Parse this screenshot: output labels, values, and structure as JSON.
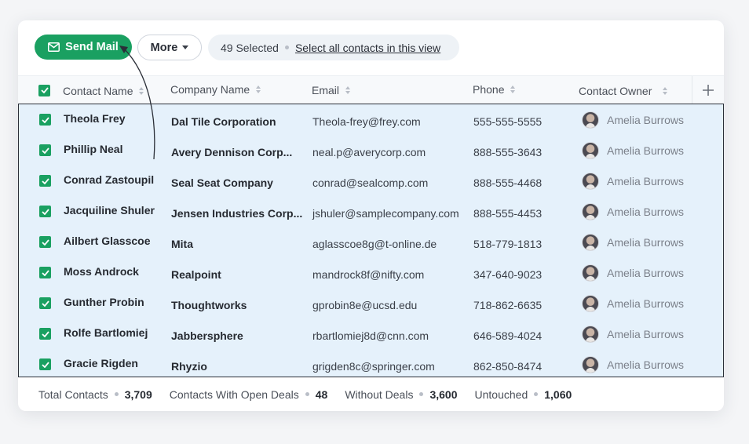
{
  "toolbar": {
    "send_mail_label": "Send Mail",
    "more_label": "More",
    "selected_count_label": "49 Selected",
    "select_all_label": "Select all contacts in this view"
  },
  "columns": {
    "contact_name": "Contact Name",
    "company_name": "Company Name",
    "email": "Email",
    "phone": "Phone",
    "contact_owner": "Contact Owner"
  },
  "rows": [
    {
      "name": "Theola Frey",
      "company": "Dal Tile Corporation",
      "email": "Theola-frey@frey.com",
      "phone": "555-555-5555",
      "owner": "Amelia Burrows"
    },
    {
      "name": "Phillip Neal",
      "company": "Avery Dennison Corp...",
      "email": "neal.p@averycorp.com",
      "phone": "888-555-3643",
      "owner": "Amelia Burrows"
    },
    {
      "name": "Conrad Zastoupil",
      "company": "Seal Seat Company",
      "email": "conrad@sealcomp.com",
      "phone": "888-555-4468",
      "owner": "Amelia Burrows"
    },
    {
      "name": "Jacquiline Shuler",
      "company": "Jensen Industries Corp...",
      "email": "jshuler@samplecompany.com",
      "phone": "888-555-4453",
      "owner": "Amelia Burrows"
    },
    {
      "name": "Ailbert Glasscoe",
      "company": "Mita",
      "email": "aglasscoe8g@t-online.de",
      "phone": "518-779-1813",
      "owner": "Amelia Burrows"
    },
    {
      "name": "Moss Androck",
      "company": "Realpoint",
      "email": "mandrock8f@nifty.com",
      "phone": "347-640-9023",
      "owner": "Amelia Burrows"
    },
    {
      "name": "Gunther Probin",
      "company": "Thoughtworks",
      "email": "gprobin8e@ucsd.edu",
      "phone": "718-862-6635",
      "owner": "Amelia Burrows"
    },
    {
      "name": "Rolfe Bartlomiej",
      "company": "Jabbersphere",
      "email": "rbartlomiej8d@cnn.com",
      "phone": "646-589-4024",
      "owner": "Amelia Burrows"
    },
    {
      "name": "Gracie Rigden",
      "company": "Rhyzio",
      "email": "grigden8c@springer.com",
      "phone": "862-850-8474",
      "owner": "Amelia Burrows"
    }
  ],
  "footer": {
    "total_label": "Total Contacts",
    "total_value": "3,709",
    "open_deals_label": "Contacts With Open Deals",
    "open_deals_value": "48",
    "without_deals_label": "Without Deals",
    "without_deals_value": "3,600",
    "untouched_label": "Untouched",
    "untouched_value": "1,060"
  },
  "colors": {
    "accent": "#1aa061",
    "selected_row_bg": "#e5f1fb"
  }
}
